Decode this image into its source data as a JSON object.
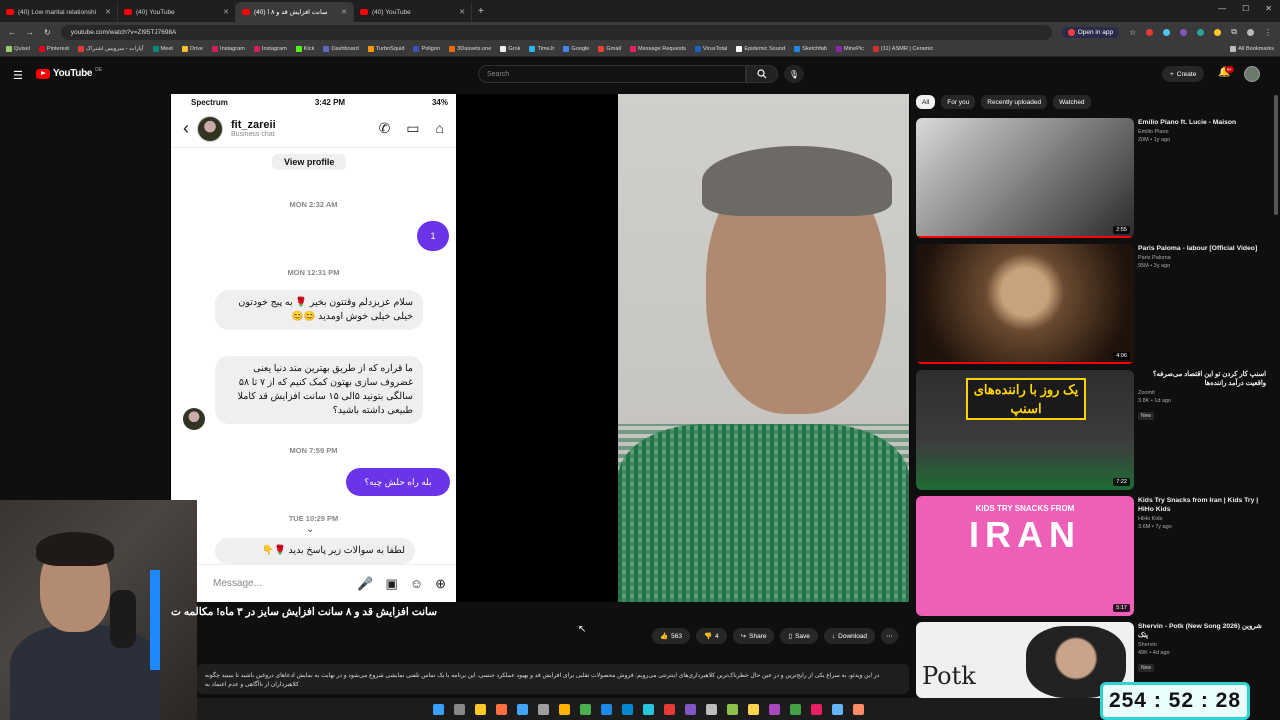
{
  "browser": {
    "tabs": [
      {
        "title": "(40) Low marital relationshi",
        "active": false
      },
      {
        "title": "(40) YouTube",
        "active": false
      },
      {
        "title": "(40) سانت افزایش قد و ۸ ا",
        "active": true
      },
      {
        "title": "(40) YouTube",
        "active": false
      }
    ],
    "url": "youtube.com/watch?v=ZI95TJ7698A",
    "open_in_app": "Open in app",
    "bookmarks": [
      "Quixel",
      "Pinterest",
      "آپارات - سرویس اشتراک",
      "Meet",
      "Drive",
      "Instagram",
      "Instagram",
      "Kick",
      "Dashboard",
      "TurboSquid",
      "Poligon",
      "3Dassets.one",
      "Grok",
      "TimeJr",
      "Google",
      "Gmail",
      "Message Requests",
      "VirusTotal",
      "Epidemic Sound",
      "Sketchfab",
      "MinePic",
      "(11) ASMR | Ceramic"
    ],
    "all_bookmarks": "All Bookmarks"
  },
  "youtube": {
    "logo": "YouTube",
    "country": "DE",
    "search_placeholder": "Search",
    "create_label": "Create",
    "notifications": "9+"
  },
  "phone": {
    "carrier": "Spectrum",
    "time": "3:42 PM",
    "battery": "34%",
    "username": "fit_zareii",
    "subtitle": "Business chat",
    "view_profile": "View profile",
    "ts1": "MON 2:32 AM",
    "out1": "1",
    "ts2": "MON 12:31 PM",
    "in1": "سلام عزیزدلم وقتتون بخیر 🌹 به پیج خودتون خیلی خیلی خوش اومدید 😊😊",
    "in2": "ما قراره که از طریق بهترین متد دنیا یعنی غضروف سازی بهتون کمک کنیم که از ۷ تا ۵۸ سالگی بتونید ۵الی ۱۵ سانت افزایش قد کاملا طبیعی داشته باشید؟",
    "ts3": "MON 7:59 PM",
    "out2": "بله راه حلش چیه؟",
    "ts4": "TUE 10:29 PM",
    "in3": "لطفا به سوالات زیر پاسخ بدید 🌹👇",
    "message_placeholder": "Message..."
  },
  "video": {
    "title": "سانت افزایش قد و ۸ سانت افزایش سایز در ۳ ماه! مکالمه ت",
    "likes": "563",
    "dislikes": "4",
    "share": "Share",
    "save": "Save",
    "download": "Download",
    "description": "در این ویدئو، به سراغ یکی از رایج‌ترین و در عین حال خطرناک‌ترین کلاهبرداری‌های اینترنتی می‌رویم: فروش محصولات تقلبی برای افزایش قد و بهبود عملکرد جنسی. این برنامه با یک تماس تلفنی نمایشی شروع می‌شود و در نهایت به نمایش ادعاهای دروغین باشید تا ببینید چگونه کلاهبرداران از ناآگاهی و عدم اعتماد به"
  },
  "chips": [
    "All",
    "For you",
    "Recently uploaded",
    "Watched"
  ],
  "recommendations": [
    {
      "title": "Emilio Piano ft. Lucie - Maison",
      "channel": "Emilio Piano",
      "stats": "20M • 1y ago",
      "duration": "2:55",
      "new": "",
      "thumb": "#8a8a8a",
      "watched": true
    },
    {
      "title": "Paris Paloma - labour [Official Video]",
      "channel": "Paris Paloma",
      "stats": "95M • 3y ago",
      "duration": "4:06",
      "new": "",
      "thumb": "#5a3a22",
      "watched": true
    },
    {
      "title": "اسنپ کار کردن تو این اقتصاد می‌صرفه؟ واقعیت درآمد راننده‌ها",
      "channel": "Zoomit",
      "stats": "3.8K • 1d ago",
      "duration": "7:22",
      "new": "New",
      "thumb": "#2a6a3a",
      "watched": false
    },
    {
      "title": "Kids Try Snacks from Iran | Kids Try | HiHo Kids",
      "channel": "HiHo Kids",
      "stats": "3.6M • 7y ago",
      "duration": "5:17",
      "new": "",
      "thumb": "#ee5fb8",
      "watched": false
    },
    {
      "title": "Shervin - Potk (New Song 2026) شروین پتک",
      "channel": "Shervin",
      "stats": "49K • 4d ago",
      "duration": "",
      "new": "New",
      "thumb": "#f0f0f0",
      "watched": false
    }
  ],
  "thumb_text": {
    "rec3": "یک روز با رانندەهای اسنپ",
    "rec4_top": "KIDS TRY SNACKS FROM",
    "rec4_big": "IRAN",
    "rec5": "Potk"
  },
  "timer": "254 : 52 : 28"
}
